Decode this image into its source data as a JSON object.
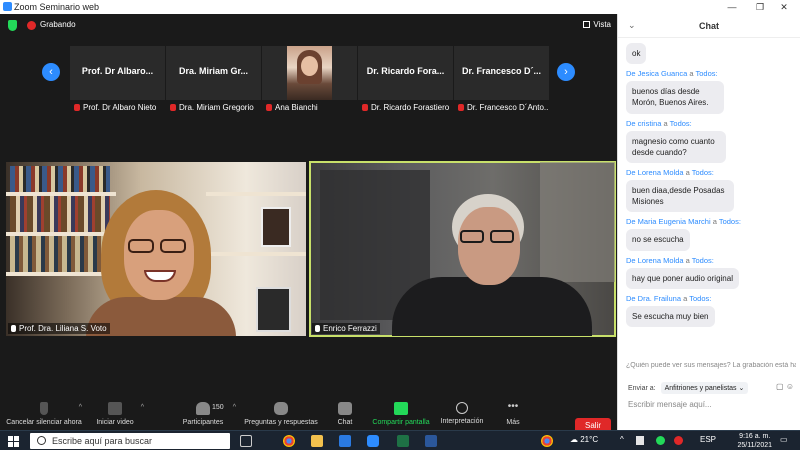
{
  "window": {
    "title": "Zoom Seminario web",
    "controls": [
      "—",
      "❐",
      "✕"
    ]
  },
  "topbar": {
    "recording": "Grabando",
    "view": "Vista"
  },
  "strip": {
    "thumbnails": [
      {
        "name": "Prof. Dr Albaro...",
        "label": "Prof. Dr Albaro Nieto"
      },
      {
        "name": "Dra. Miriam  Gr...",
        "label": "Dra. Miriam  Gregorio"
      },
      {
        "name": "",
        "label": "Ana Bianchi"
      },
      {
        "name": "Dr. Ricardo Fora...",
        "label": "Dr. Ricardo Forastiero"
      },
      {
        "name": "Dr. Francesco D´...",
        "label": "Dr. Francesco D´Anto..."
      }
    ]
  },
  "videos": [
    {
      "label": "Prof. Dra. Liliana S. Voto"
    },
    {
      "label": "Enrico Ferrazzi"
    }
  ],
  "toolbar": {
    "mute": "Cancelar silenciar ahora",
    "video": "Iniciar video",
    "participants": "Participantes",
    "participants_count": "150",
    "qa": "Preguntas y respuestas",
    "chat": "Chat",
    "share": "Compartir pantalla",
    "interpret": "Interpretación",
    "more": "Más",
    "leave": "Salir"
  },
  "chat": {
    "title": "Chat",
    "messages": [
      {
        "from": "",
        "to": "",
        "text": "ok"
      },
      {
        "from": "Jesica Guanca",
        "to": "Todos",
        "text": "buenos días desde Morón, Buenos Aires."
      },
      {
        "from": "cristina",
        "to": "Todos",
        "text": "magnesio como cuanto desde cuando?"
      },
      {
        "from": "Lorena Molda",
        "to": "Todos",
        "text": "buen diaa,desde Posadas Misiones"
      },
      {
        "from": "Maria Eugenia Marchi",
        "to": "Todos",
        "text": "no se escucha"
      },
      {
        "from": "Lorena Molda",
        "to": "Todos",
        "text": "hay que poner audio original"
      },
      {
        "from": "Dra. Frailuna",
        "to": "Todos",
        "text": "Se escucha muy bien"
      }
    ],
    "connector": "a",
    "notice": "¿Quién puede ver sus mensajes? La grabación está habilitada",
    "send_to_label": "Enviar a:",
    "send_to_value": "Anfitriones y panelistas",
    "placeholder": "Escribir mensaje aquí..."
  },
  "taskbar": {
    "search_placeholder": "Escribe aquí para buscar",
    "weather": "21°C",
    "lang": "ESP",
    "time": "9:16 a. m.",
    "date": "25/11/2021"
  }
}
